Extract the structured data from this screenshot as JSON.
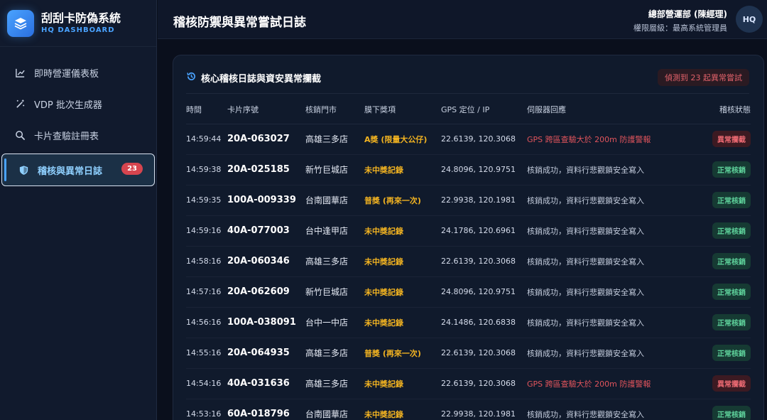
{
  "brand": {
    "title": "刮刮卡防偽系統",
    "subtitle": "HQ DASHBOARD",
    "logo_icon": "layers-icon"
  },
  "nav": {
    "items": [
      {
        "label": "即時營運儀表板",
        "icon": "chart-line-icon"
      },
      {
        "label": "VDP 批次生成器",
        "icon": "magic-wand-icon"
      },
      {
        "label": "卡片查驗註冊表",
        "icon": "search-icon"
      },
      {
        "label": "稽核與異常日誌",
        "icon": "shield-icon",
        "badge": "23",
        "active": true
      }
    ]
  },
  "header": {
    "title": "稽核防禦與異常嘗試日誌",
    "user_name": "總部營運部 (陳經理)",
    "user_role": "權限層級：最高系統管理員",
    "avatar": "HQ"
  },
  "panel": {
    "title": "核心稽核日誌與資安異常攔截",
    "icon": "history-icon",
    "alert": "偵測到 23 起異常嘗試"
  },
  "table": {
    "columns": [
      "時間",
      "卡片序號",
      "核銷門市",
      "膜下獎項",
      "GPS 定位 / IP",
      "伺服器回應",
      "稽核狀態"
    ],
    "rows": [
      {
        "time": "14:59:44",
        "serial": "20A-063027",
        "store": "高雄三多店",
        "prize": "A獎 (限量大公仔)",
        "gps": "22.6139, 120.3068",
        "response": "GPS 跨區查驗大於 200m 防護警報",
        "status": "異常攔截",
        "ok": false
      },
      {
        "time": "14:59:38",
        "serial": "20A-025185",
        "store": "新竹巨城店",
        "prize": "未中獎記錄",
        "gps": "24.8096, 120.9751",
        "response": "核銷成功，資料行悲觀鎖安全寫入",
        "status": "正常核銷",
        "ok": true
      },
      {
        "time": "14:59:35",
        "serial": "100A-009339",
        "store": "台南國華店",
        "prize": "普獎 (再來一次)",
        "gps": "22.9938, 120.1981",
        "response": "核銷成功，資料行悲觀鎖安全寫入",
        "status": "正常核銷",
        "ok": true
      },
      {
        "time": "14:59:16",
        "serial": "40A-077003",
        "store": "台中逢甲店",
        "prize": "未中獎記錄",
        "gps": "24.1786, 120.6961",
        "response": "核銷成功，資料行悲觀鎖安全寫入",
        "status": "正常核銷",
        "ok": true
      },
      {
        "time": "14:58:16",
        "serial": "20A-060346",
        "store": "高雄三多店",
        "prize": "未中獎記錄",
        "gps": "22.6139, 120.3068",
        "response": "核銷成功，資料行悲觀鎖安全寫入",
        "status": "正常核銷",
        "ok": true
      },
      {
        "time": "14:57:16",
        "serial": "20A-062609",
        "store": "新竹巨城店",
        "prize": "未中獎記錄",
        "gps": "24.8096, 120.9751",
        "response": "核銷成功，資料行悲觀鎖安全寫入",
        "status": "正常核銷",
        "ok": true
      },
      {
        "time": "14:56:16",
        "serial": "100A-038091",
        "store": "台中一中店",
        "prize": "未中獎記錄",
        "gps": "24.1486, 120.6838",
        "response": "核銷成功，資料行悲觀鎖安全寫入",
        "status": "正常核銷",
        "ok": true
      },
      {
        "time": "14:55:16",
        "serial": "20A-064935",
        "store": "高雄三多店",
        "prize": "普獎 (再來一次)",
        "gps": "22.6139, 120.3068",
        "response": "核銷成功，資料行悲觀鎖安全寫入",
        "status": "正常核銷",
        "ok": true
      },
      {
        "time": "14:54:16",
        "serial": "40A-031636",
        "store": "高雄三多店",
        "prize": "未中獎記錄",
        "gps": "22.6139, 120.3068",
        "response": "GPS 跨區查驗大於 200m 防護警報",
        "status": "異常攔截",
        "ok": false
      },
      {
        "time": "14:53:16",
        "serial": "60A-018796",
        "store": "台南國華店",
        "prize": "未中獎記錄",
        "gps": "22.9938, 120.1981",
        "response": "核銷成功，資料行悲觀鎖安全寫入",
        "status": "正常核銷",
        "ok": true
      }
    ]
  },
  "colors": {
    "accent": "#4aa3ff",
    "prize": "#f2b321",
    "danger": "#e0545c",
    "success": "#5fd39c",
    "badge": "#d6454f"
  }
}
